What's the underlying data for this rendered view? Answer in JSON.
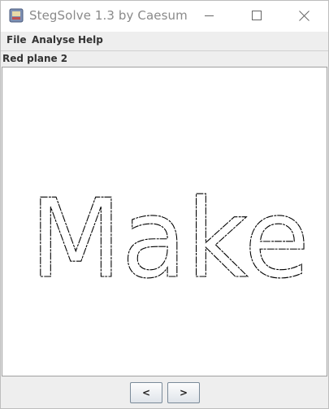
{
  "window": {
    "title": "StegSolve 1.3 by Caesum",
    "icons": [
      "app-icon",
      "minimize-icon",
      "maximize-icon",
      "close-icon"
    ]
  },
  "menu": {
    "items": [
      {
        "label": "File"
      },
      {
        "label": "Analyse"
      },
      {
        "label": "Help"
      }
    ]
  },
  "panel": {
    "plane_label": "Red plane 2",
    "image_text": "Make"
  },
  "navigation": {
    "prev_label": "<",
    "next_label": ">"
  },
  "colors": {
    "background": "#eeeeee",
    "image_background": "#ffffff",
    "stroke": "#000000"
  }
}
